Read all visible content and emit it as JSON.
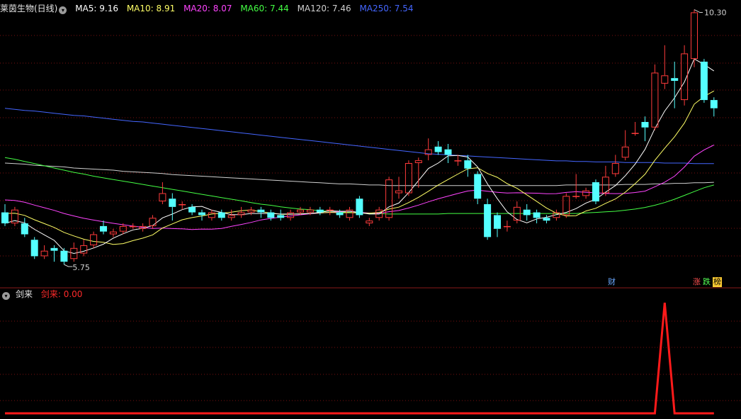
{
  "header": {
    "title": "莱茵生物(日线)",
    "ma": [
      {
        "label": "MA5: 9.16",
        "color": "#ffffff"
      },
      {
        "label": "MA10: 8.91",
        "color": "#ffff66"
      },
      {
        "label": "MA20: 8.07",
        "color": "#ff44ff"
      },
      {
        "label": "MA60: 7.44",
        "color": "#44ff44"
      },
      {
        "label": "MA120: 7.46",
        "color": "#d0d0d0"
      },
      {
        "label": "MA250: 7.54",
        "color": "#4466ff"
      }
    ]
  },
  "sub_header": {
    "name": "剑来",
    "value_label": "剑来: 0.00"
  },
  "badges": {
    "cai": "财",
    "zhang": "涨",
    "die": "跌",
    "bang": "榜"
  },
  "colors": {
    "up": "#ff3b3b",
    "down": "#54ffff",
    "grid": "#7a1010",
    "border": "#8a1a1a",
    "ma5": "#ffffff",
    "ma10": "#ffff66",
    "ma20": "#ff44ff",
    "ma60": "#44ff44",
    "ma120": "#d0d0d0",
    "ma250": "#4466ff",
    "indicator": "#ff1a1a"
  },
  "chart_data": {
    "type": "candlestick",
    "price_labels": {
      "high": "10.30",
      "low": "5.75"
    },
    "candles": [
      [
        6.65,
        6.45,
        6.8,
        6.4
      ],
      [
        6.45,
        6.7,
        6.75,
        6.4
      ],
      [
        6.45,
        6.25,
        6.55,
        6.2
      ],
      [
        6.15,
        5.85,
        6.2,
        5.8
      ],
      [
        5.85,
        5.95,
        6.05,
        5.8
      ],
      [
        6.0,
        5.95,
        6.05,
        5.75
      ],
      [
        5.95,
        5.75,
        6.0,
        5.7
      ],
      [
        5.8,
        6.0,
        6.1,
        5.75
      ],
      [
        5.9,
        6.05,
        6.15,
        5.85
      ],
      [
        6.05,
        6.25,
        6.3,
        6.0
      ],
      [
        6.4,
        6.3,
        6.5,
        6.25
      ],
      [
        6.25,
        6.3,
        6.35,
        6.2
      ],
      [
        6.3,
        6.4,
        6.45,
        6.25
      ],
      [
        6.4,
        6.4,
        6.45,
        6.35
      ],
      [
        6.35,
        6.4,
        6.45,
        6.3
      ],
      [
        6.4,
        6.55,
        6.6,
        6.35
      ],
      [
        6.85,
        7.0,
        7.2,
        6.8
      ],
      [
        6.9,
        6.75,
        7.0,
        6.5
      ],
      [
        6.8,
        6.8,
        6.85,
        6.7
      ],
      [
        6.75,
        6.65,
        6.8,
        6.6
      ],
      [
        6.65,
        6.6,
        6.7,
        6.5
      ],
      [
        6.55,
        6.65,
        6.7,
        6.5
      ],
      [
        6.65,
        6.55,
        6.7,
        6.5
      ],
      [
        6.55,
        6.6,
        6.7,
        6.5
      ],
      [
        6.6,
        6.65,
        6.75,
        6.55
      ],
      [
        6.65,
        6.7,
        6.75,
        6.6
      ],
      [
        6.7,
        6.65,
        6.75,
        6.55
      ],
      [
        6.65,
        6.55,
        6.7,
        6.5
      ],
      [
        6.6,
        6.55,
        6.7,
        6.5
      ],
      [
        6.55,
        6.65,
        6.7,
        6.5
      ],
      [
        6.65,
        6.7,
        6.75,
        6.6
      ],
      [
        6.65,
        6.7,
        6.75,
        6.6
      ],
      [
        6.7,
        6.65,
        6.75,
        6.6
      ],
      [
        6.7,
        6.7,
        6.75,
        6.6
      ],
      [
        6.65,
        6.6,
        6.7,
        6.55
      ],
      [
        6.55,
        6.7,
        6.75,
        6.5
      ],
      [
        6.9,
        6.6,
        6.95,
        6.55
      ],
      [
        6.45,
        6.5,
        6.55,
        6.4
      ],
      [
        6.55,
        6.7,
        6.75,
        6.5
      ],
      [
        6.55,
        7.25,
        7.3,
        6.5
      ],
      [
        7.0,
        7.05,
        7.3,
        6.9
      ],
      [
        7.0,
        7.55,
        7.6,
        6.95
      ],
      [
        7.55,
        7.6,
        7.65,
        7.1
      ],
      [
        7.7,
        7.8,
        8.0,
        7.6
      ],
      [
        7.85,
        7.75,
        7.95,
        7.7
      ],
      [
        7.8,
        7.7,
        7.9,
        7.55
      ],
      [
        7.6,
        7.6,
        7.7,
        7.5
      ],
      [
        7.6,
        7.45,
        7.7,
        7.3
      ],
      [
        7.35,
        6.9,
        7.4,
        6.8
      ],
      [
        6.8,
        6.2,
        6.9,
        6.15
      ],
      [
        6.6,
        6.35,
        6.65,
        6.2
      ],
      [
        6.4,
        6.4,
        6.5,
        6.3
      ],
      [
        6.5,
        6.75,
        6.85,
        6.45
      ],
      [
        6.7,
        6.6,
        6.8,
        6.5
      ],
      [
        6.65,
        6.55,
        6.7,
        6.45
      ],
      [
        6.55,
        6.5,
        6.6,
        6.45
      ],
      [
        6.55,
        6.65,
        6.7,
        6.5
      ],
      [
        6.6,
        6.95,
        7.0,
        6.55
      ],
      [
        6.95,
        6.95,
        7.35,
        6.9
      ],
      [
        6.95,
        7.05,
        7.1,
        6.9
      ],
      [
        7.2,
        6.85,
        7.25,
        6.8
      ],
      [
        7.0,
        7.3,
        7.5,
        6.95
      ],
      [
        7.35,
        7.55,
        7.7,
        7.3
      ],
      [
        7.65,
        7.85,
        8.15,
        7.6
      ],
      [
        8.1,
        8.1,
        8.3,
        8.05
      ],
      [
        8.3,
        8.2,
        8.4,
        7.95
      ],
      [
        8.2,
        9.2,
        9.35,
        8.15
      ],
      [
        9.0,
        9.15,
        9.7,
        8.9
      ],
      [
        9.1,
        9.05,
        9.4,
        8.55
      ],
      [
        8.7,
        9.55,
        9.7,
        8.6
      ],
      [
        9.45,
        10.3,
        10.35,
        9.3
      ],
      [
        9.4,
        8.7,
        9.45,
        8.65
      ],
      [
        8.7,
        8.55,
        8.75,
        8.4
      ]
    ],
    "indicator": {
      "name": "剑来",
      "values": [
        0,
        0,
        0,
        0,
        0,
        0,
        0,
        0,
        0,
        0,
        0,
        0,
        0,
        0,
        0,
        0,
        0,
        0,
        0,
        0,
        0,
        0,
        0,
        0,
        0,
        0,
        0,
        0,
        0,
        0,
        0,
        0,
        0,
        0,
        0,
        0,
        0,
        0,
        0,
        0,
        0,
        0,
        0,
        0,
        0,
        0,
        0,
        0,
        0,
        0,
        0,
        0,
        0,
        0,
        0,
        0,
        0,
        0,
        0,
        0,
        0,
        0,
        0,
        0,
        0,
        0,
        0,
        1,
        0,
        0,
        0,
        0,
        0
      ]
    },
    "ma10_start": 6.65,
    "ma20_start": 6.9,
    "ma60_series": [
      7.65,
      7.62,
      7.58,
      7.54,
      7.5,
      7.46,
      7.42,
      7.38,
      7.35,
      7.31,
      7.28,
      7.25,
      7.22,
      7.19,
      7.16,
      7.13,
      7.1,
      7.07,
      7.04,
      7.01,
      6.98,
      6.95,
      6.92,
      6.89,
      6.86,
      6.83,
      6.8,
      6.78,
      6.75,
      6.73,
      6.71,
      6.7,
      6.68,
      6.67,
      6.66,
      6.65,
      6.64,
      6.63,
      6.63,
      6.62,
      6.62,
      6.62,
      6.62,
      6.62,
      6.62,
      6.63,
      6.63,
      6.63,
      6.63,
      6.63,
      6.63,
      6.63,
      6.63,
      6.63,
      6.63,
      6.63,
      6.63,
      6.63,
      6.63,
      6.64,
      6.65,
      6.66,
      6.67,
      6.69,
      6.71,
      6.74,
      6.78,
      6.83,
      6.89,
      6.96,
      7.03,
      7.1,
      7.15
    ],
    "ma120_series": [
      7.55,
      7.54,
      7.53,
      7.51,
      7.5,
      7.49,
      7.48,
      7.46,
      7.45,
      7.44,
      7.43,
      7.42,
      7.4,
      7.39,
      7.38,
      7.37,
      7.36,
      7.34,
      7.33,
      7.32,
      7.31,
      7.3,
      7.29,
      7.28,
      7.27,
      7.26,
      7.25,
      7.24,
      7.23,
      7.22,
      7.21,
      7.2,
      7.19,
      7.18,
      7.17,
      7.17,
      7.16,
      7.15,
      7.15,
      7.14,
      7.14,
      7.14,
      7.14,
      7.14,
      7.14,
      7.14,
      7.14,
      7.14,
      7.14,
      7.14,
      7.14,
      7.14,
      7.14,
      7.14,
      7.14,
      7.14,
      7.14,
      7.15,
      7.15,
      7.15,
      7.15,
      7.15,
      7.15,
      7.16,
      7.16,
      7.16,
      7.17,
      7.17,
      7.18,
      7.18,
      7.19,
      7.19,
      7.2
    ],
    "ma250_series": [
      8.55,
      8.53,
      8.51,
      8.5,
      8.48,
      8.46,
      8.44,
      8.42,
      8.41,
      8.39,
      8.37,
      8.35,
      8.33,
      8.31,
      8.3,
      8.28,
      8.26,
      8.24,
      8.22,
      8.2,
      8.18,
      8.16,
      8.14,
      8.12,
      8.1,
      8.08,
      8.06,
      8.04,
      8.02,
      8.0,
      7.98,
      7.96,
      7.94,
      7.92,
      7.9,
      7.88,
      7.86,
      7.84,
      7.82,
      7.8,
      7.78,
      7.76,
      7.74,
      7.72,
      7.71,
      7.7,
      7.69,
      7.68,
      7.67,
      7.66,
      7.65,
      7.64,
      7.63,
      7.62,
      7.61,
      7.6,
      7.59,
      7.59,
      7.58,
      7.58,
      7.57,
      7.57,
      7.57,
      7.56,
      7.56,
      7.56,
      7.56,
      7.55,
      7.55,
      7.55,
      7.54,
      7.54,
      7.54
    ]
  }
}
